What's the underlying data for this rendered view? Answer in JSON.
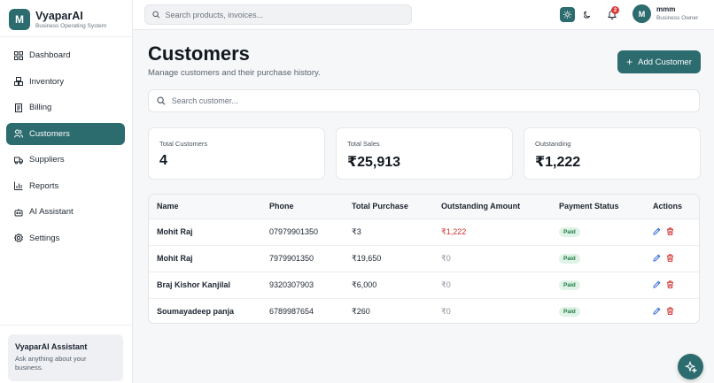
{
  "brand": {
    "logo_letter": "M",
    "name": "VyaparAI",
    "tagline": "Business Operating System"
  },
  "sidebar": {
    "items": [
      {
        "label": "Dashboard",
        "icon": "grid-icon"
      },
      {
        "label": "Inventory",
        "icon": "boxes-icon"
      },
      {
        "label": "Billing",
        "icon": "receipt-icon"
      },
      {
        "label": "Customers",
        "icon": "users-icon",
        "active": true
      },
      {
        "label": "Suppliers",
        "icon": "truck-icon"
      },
      {
        "label": "Reports",
        "icon": "bar-chart-icon"
      },
      {
        "label": "AI Assistant",
        "icon": "bot-icon"
      },
      {
        "label": "Settings",
        "icon": "gear-icon"
      }
    ],
    "assistant_card": {
      "title": "VyaparAI Assistant",
      "description": "Ask anything about your business."
    }
  },
  "topbar": {
    "search_placeholder": "Search products, invoices...",
    "notification_count": "2",
    "user": {
      "avatar_letter": "M",
      "name": "mmm",
      "role": "Business Owner"
    }
  },
  "page": {
    "title": "Customers",
    "subtitle": "Manage customers and their purchase history.",
    "add_button": "Add Customer",
    "search_placeholder": "Search customer..."
  },
  "stats": [
    {
      "label": "Total Customers",
      "value": "4"
    },
    {
      "label": "Total Sales",
      "value": "₹25,913"
    },
    {
      "label": "Outstanding",
      "value": "₹1,222"
    }
  ],
  "table": {
    "columns": [
      "Name",
      "Phone",
      "Total Purchase",
      "Outstanding Amount",
      "Payment Status",
      "Actions"
    ],
    "rows": [
      {
        "name": "Mohit Raj",
        "phone": "07979901350",
        "total": "₹3",
        "outstanding": "₹1,222",
        "status": "Paid"
      },
      {
        "name": "Mohit Raj",
        "phone": "7979901350",
        "total": "₹19,650",
        "outstanding": "₹0",
        "status": "Paid"
      },
      {
        "name": "Braj Kishor Kanjilal",
        "phone": "9320307903",
        "total": "₹6,000",
        "outstanding": "₹0",
        "status": "Paid"
      },
      {
        "name": "Soumayadeep panja",
        "phone": "6789987654",
        "total": "₹260",
        "outstanding": "₹0",
        "status": "Paid"
      }
    ]
  },
  "colors": {
    "primary": "#2c6b6e",
    "danger": "#d12e2e",
    "paid_bg": "#dff3e6",
    "paid_text": "#1f7a43",
    "edit": "#3b6fd6"
  }
}
